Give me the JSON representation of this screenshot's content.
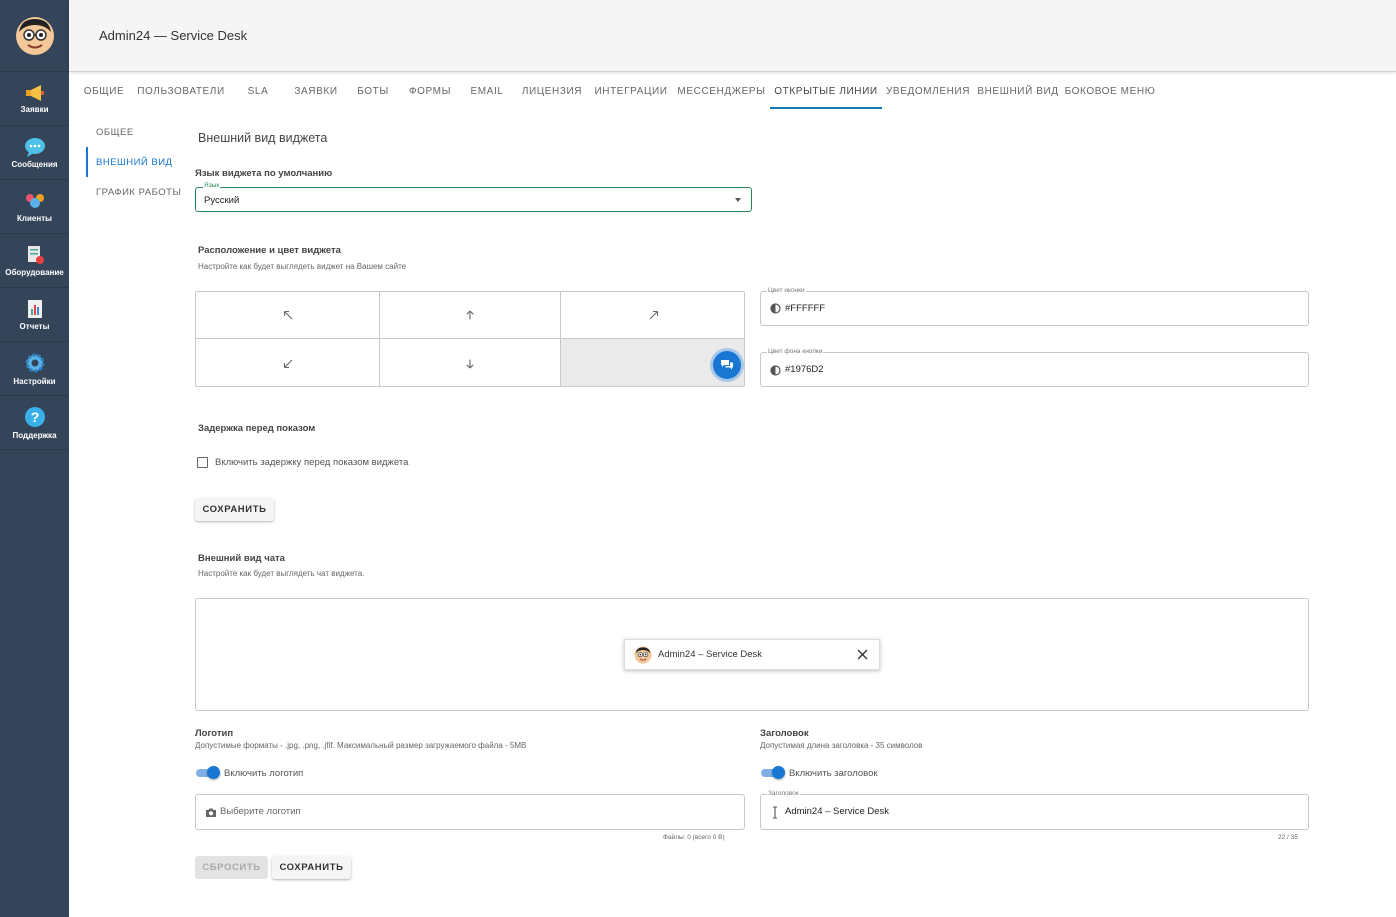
{
  "app": {
    "title": "Admin24 — Service Desk"
  },
  "sidebar": {
    "items": [
      {
        "label": "Заявки",
        "icon": "megaphone-icon"
      },
      {
        "label": "Сообщения",
        "icon": "chat-bubble-icon"
      },
      {
        "label": "Клиенты",
        "icon": "users-icon"
      },
      {
        "label": "Оборудование",
        "icon": "equipment-icon"
      },
      {
        "label": "Отчеты",
        "icon": "report-icon"
      },
      {
        "label": "Настройки",
        "icon": "gear-icon"
      },
      {
        "label": "Поддержка",
        "icon": "help-icon"
      }
    ]
  },
  "tabs": [
    {
      "label": "Общие"
    },
    {
      "label": "Пользователи"
    },
    {
      "label": "SLA"
    },
    {
      "label": "Заявки"
    },
    {
      "label": "Боты"
    },
    {
      "label": "Формы"
    },
    {
      "label": "Email"
    },
    {
      "label": "Лицензия"
    },
    {
      "label": "Интеграции"
    },
    {
      "label": "Мессенджеры"
    },
    {
      "label": "Открытые линии",
      "active": true
    },
    {
      "label": "Уведомления"
    },
    {
      "label": "Внешний вид"
    },
    {
      "label": "Боковое меню"
    }
  ],
  "subnav": [
    {
      "label": "Общее"
    },
    {
      "label": "Внешний вид",
      "active": true
    },
    {
      "label": "График работы"
    }
  ],
  "widget": {
    "title": "Внешний вид виджета",
    "language_heading": "Язык виджета по умолчанию",
    "language_field_label": "Язык",
    "language_value": "Русский",
    "position_heading": "Расположение и цвет виджета",
    "position_hint": "Настройте как будет выглядеть виджет на Вашем сайте",
    "selected_position": "bottom-right",
    "icon_color_label": "Цвет иконки",
    "icon_color_value": "#FFFFFF",
    "button_bg_label": "Цвет фона кнопки",
    "button_bg_value": "#1976D2",
    "delay_heading": "Задержка перед показом",
    "delay_checkbox_label": "Включить задержку перед показом виджета",
    "delay_enabled": false,
    "save_label": "Сохранить"
  },
  "chat": {
    "heading": "Внешний вид чата",
    "hint": "Настройте как будет выглядеть чат виджета.",
    "preview_title": "Admin24 – Service Desk",
    "logo_heading": "Логотип",
    "logo_hint": "Допустимые форматы - .jpg, .png, .jfif. Максимальный размер загружаемого файла - 5MB",
    "logo_toggle_label": "Включить логотип",
    "logo_enabled": true,
    "logo_placeholder": "Выберите логотип",
    "logo_files_text": "Файлы: 0 (всего 0 B)",
    "header_heading": "Заголовок",
    "header_hint": "Допустимая длина заголовка - 35 символов",
    "header_toggle_label": "Включить заголовок",
    "header_enabled": true,
    "header_field_label": "Заголовок",
    "header_value": "Admin24 – Service Desk",
    "header_counter": "22 / 35",
    "reset_label": "Сбросить",
    "save_label": "Сохранить"
  },
  "colors": {
    "sidebar_bg": "#34455a",
    "accent": "#1976d2",
    "active_tab_underline": "#1a7db8",
    "select_border": "#2c8a5a"
  }
}
